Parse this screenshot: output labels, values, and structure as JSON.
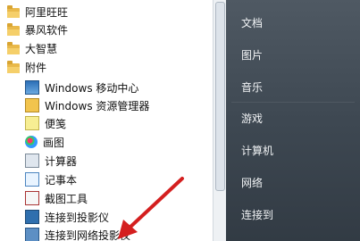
{
  "programs": {
    "items": [
      {
        "type": "folder",
        "label": "阿里旺旺",
        "icon": "folder-icon"
      },
      {
        "type": "folder",
        "label": "暴风软件",
        "icon": "folder-icon"
      },
      {
        "type": "folder",
        "label": "大智慧",
        "icon": "folder-icon"
      },
      {
        "type": "folder",
        "label": "附件",
        "icon": "folder-icon"
      },
      {
        "type": "item",
        "label": "Windows 移动中心",
        "icon": "mobility-center-icon"
      },
      {
        "type": "item",
        "label": "Windows 资源管理器",
        "icon": "explorer-icon"
      },
      {
        "type": "item",
        "label": "便笺",
        "icon": "sticky-notes-icon"
      },
      {
        "type": "item",
        "label": "画图",
        "icon": "paint-icon"
      },
      {
        "type": "item",
        "label": "计算器",
        "icon": "calculator-icon"
      },
      {
        "type": "item",
        "label": "记事本",
        "icon": "notepad-icon"
      },
      {
        "type": "item",
        "label": "截图工具",
        "icon": "snipping-tool-icon"
      },
      {
        "type": "item",
        "label": "连接到投影仪",
        "icon": "projector-icon"
      },
      {
        "type": "item",
        "label": "连接到网络投影仪",
        "icon": "network-projector-icon"
      }
    ]
  },
  "links": {
    "items": [
      "文档",
      "图片",
      "音乐",
      "游戏",
      "计算机",
      "网络",
      "连接到"
    ]
  },
  "colors": {
    "annotation_arrow": "#d41f1f"
  }
}
